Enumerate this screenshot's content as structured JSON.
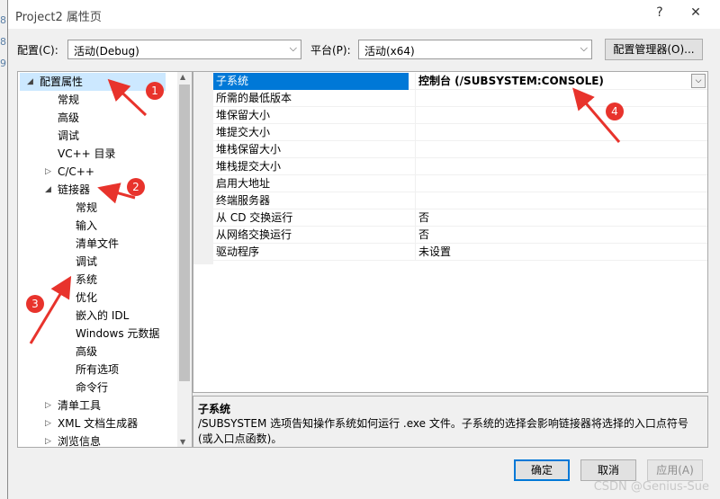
{
  "background": {
    "strip1": "8",
    "strip2": "9",
    "strip3": "8"
  },
  "window": {
    "title": "Project2 属性页",
    "help": "?",
    "close": "✕"
  },
  "toolbar": {
    "config_label": "配置(C):",
    "config_value": "活动(Debug)",
    "platform_label": "平台(P):",
    "platform_value": "活动(x64)",
    "config_manager": "配置管理器(O)..."
  },
  "tree": {
    "items": [
      {
        "label": "配置属性",
        "twisty": "◢"
      },
      {
        "label": "常规"
      },
      {
        "label": "高级"
      },
      {
        "label": "调试"
      },
      {
        "label": "VC++ 目录"
      },
      {
        "label": "C/C++",
        "twisty": "▷"
      },
      {
        "label": "链接器",
        "twisty": "◢"
      },
      {
        "label": "常规"
      },
      {
        "label": "输入"
      },
      {
        "label": "清单文件"
      },
      {
        "label": "调试"
      },
      {
        "label": "系统"
      },
      {
        "label": "优化"
      },
      {
        "label": "嵌入的 IDL"
      },
      {
        "label": "Windows 元数据"
      },
      {
        "label": "高级"
      },
      {
        "label": "所有选项"
      },
      {
        "label": "命令行"
      },
      {
        "label": "清单工具",
        "twisty": "▷"
      },
      {
        "label": "XML 文档生成器",
        "twisty": "▷"
      },
      {
        "label": "浏览信息",
        "twisty": "▷"
      }
    ]
  },
  "grid": {
    "rows": [
      {
        "name": "子系统",
        "value": "控制台 (/SUBSYSTEM:CONSOLE)"
      },
      {
        "name": "所需的最低版本",
        "value": ""
      },
      {
        "name": "堆保留大小",
        "value": ""
      },
      {
        "name": "堆提交大小",
        "value": ""
      },
      {
        "name": "堆栈保留大小",
        "value": ""
      },
      {
        "name": "堆栈提交大小",
        "value": ""
      },
      {
        "name": "启用大地址",
        "value": ""
      },
      {
        "name": "终端服务器",
        "value": ""
      },
      {
        "name": "从 CD 交换运行",
        "value": "否"
      },
      {
        "name": "从网络交换运行",
        "value": "否"
      },
      {
        "name": "驱动程序",
        "value": "未设置"
      }
    ]
  },
  "description": {
    "title": "子系统",
    "text": "/SUBSYSTEM 选项告知操作系统如何运行 .exe 文件。子系统的选择会影响链接器将选择的入口点符号(或入口点函数)。"
  },
  "buttons": {
    "ok": "确定",
    "cancel": "取消",
    "apply": "应用(A)"
  },
  "annotations": {
    "n1": "1",
    "n2": "2",
    "n3": "3",
    "n4": "4",
    "color": "#e8332c"
  },
  "watermark": "CSDN @Genius-Sue"
}
